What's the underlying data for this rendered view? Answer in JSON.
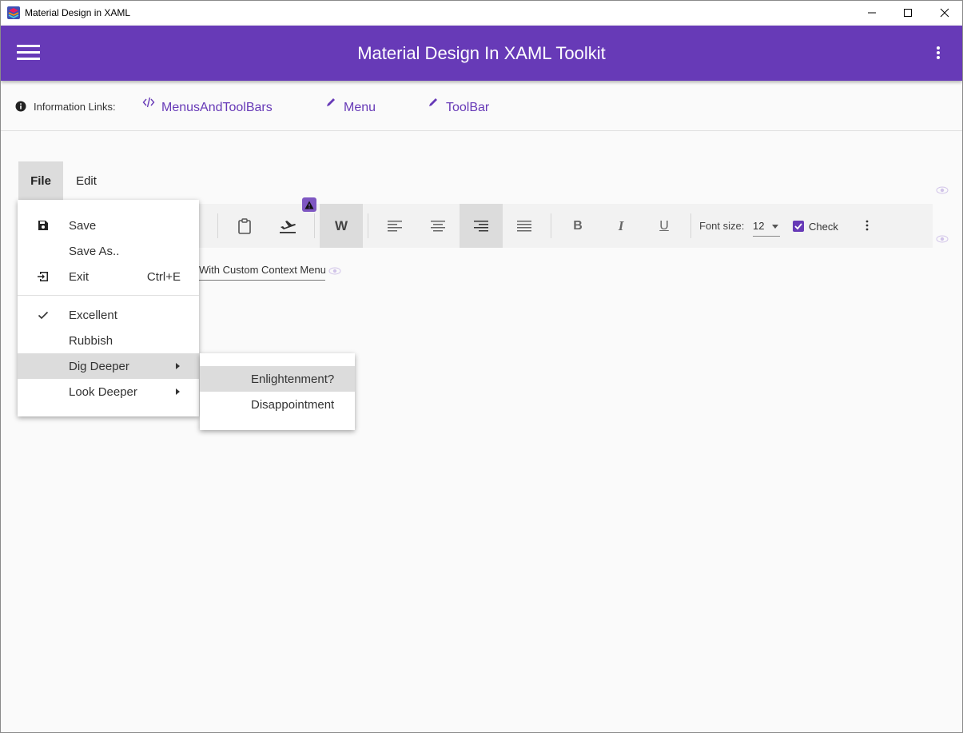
{
  "window": {
    "title": "Material Design in XAML"
  },
  "appbar": {
    "title": "Material Design In XAML Toolkit",
    "color": "#673ab7"
  },
  "info": {
    "label": "Information Links:",
    "links": [
      "MenusAndToolBars",
      "Menu",
      "ToolBar"
    ]
  },
  "menubar": {
    "file": "File",
    "edit": "Edit"
  },
  "file_menu": {
    "items": [
      {
        "label": "Save",
        "icon": "save-icon"
      },
      {
        "label": "Save As..",
        "icon": ""
      },
      {
        "label": "Exit",
        "icon": "exit-icon",
        "shortcut": "Ctrl+E"
      },
      {
        "label": "Excellent",
        "icon": "check-icon"
      },
      {
        "label": "Rubbish",
        "icon": ""
      },
      {
        "label": "Dig Deeper",
        "icon": "",
        "submenu": true
      },
      {
        "label": "Look Deeper",
        "icon": "",
        "submenu": true
      }
    ]
  },
  "submenu": {
    "items": [
      "Enlightenment?",
      "Disappointment"
    ]
  },
  "toolbar": {
    "font_label": "Font size:",
    "font_size": "12",
    "check_label": "Check",
    "check_value": true,
    "word_wrap_label": "W"
  },
  "context_field": {
    "text": "With Custom Context Menu"
  }
}
